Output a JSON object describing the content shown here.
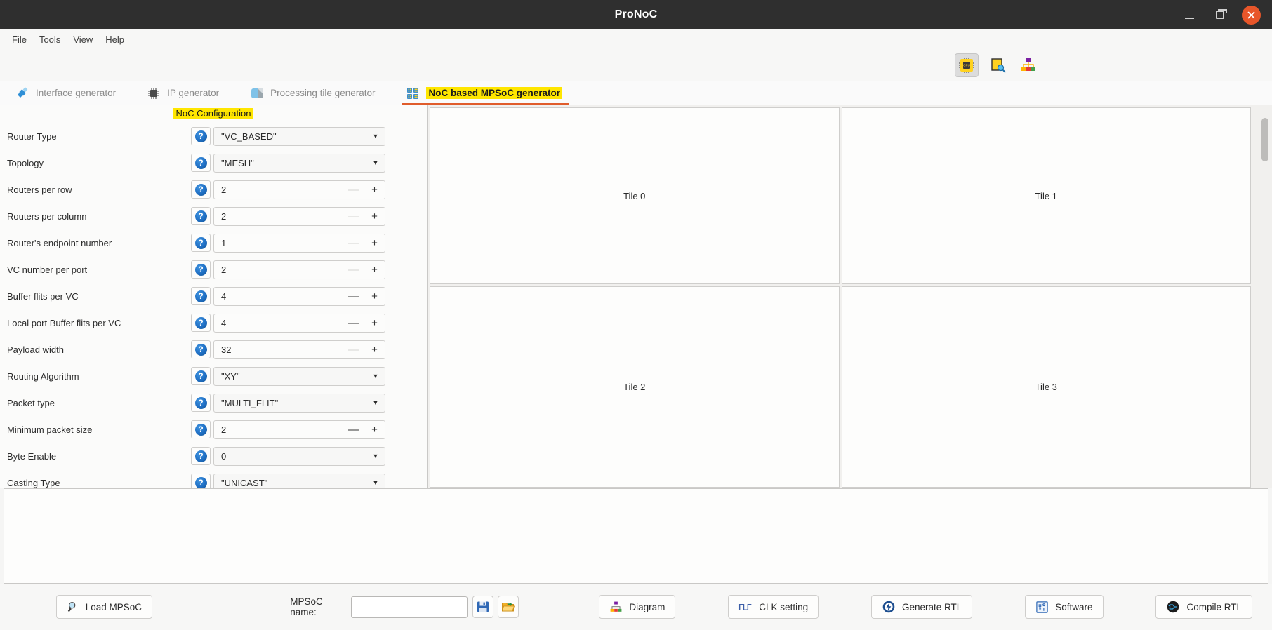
{
  "window": {
    "title": "ProNoC",
    "minimize_label": "Minimize",
    "maximize_label": "Maximize",
    "close_label": "Close"
  },
  "menubar": {
    "items": [
      {
        "label": "File"
      },
      {
        "label": "Tools"
      },
      {
        "label": "View"
      },
      {
        "label": "Help"
      }
    ]
  },
  "toolbar": {
    "buttons": [
      {
        "icon": "cpu-chip-icon",
        "active": true
      },
      {
        "icon": "document-search-icon",
        "active": false
      },
      {
        "icon": "hierarchy-diagram-icon",
        "active": false
      }
    ]
  },
  "tabs": [
    {
      "label": "Interface generator",
      "icon": "connector-plug-icon",
      "active": false
    },
    {
      "label": "IP generator",
      "icon": "ic-chip-icon",
      "active": false
    },
    {
      "label": "Processing tile generator",
      "icon": "cube-tile-icon",
      "active": false
    },
    {
      "label": "NoC based MPSoC generator",
      "icon": "grid-2x2-icon",
      "active": true
    }
  ],
  "config": {
    "header": "NoC Configuration",
    "help_glyph": "?",
    "rows": [
      {
        "label": "Router Type",
        "type": "combo",
        "value": "\"VC_BASED\""
      },
      {
        "label": "Topology",
        "type": "combo",
        "value": "\"MESH\""
      },
      {
        "label": "Routers per row",
        "type": "spinner",
        "value": "2",
        "minus_enabled": false,
        "plus_enabled": true
      },
      {
        "label": "Routers per column",
        "type": "spinner",
        "value": "2",
        "minus_enabled": false,
        "plus_enabled": true
      },
      {
        "label": "Router's endpoint number",
        "type": "spinner",
        "value": "1",
        "minus_enabled": false,
        "plus_enabled": true
      },
      {
        "label": "VC number per port",
        "type": "spinner",
        "value": "2",
        "minus_enabled": false,
        "plus_enabled": true
      },
      {
        "label": "Buffer flits per VC",
        "type": "spinner",
        "value": "4",
        "minus_enabled": true,
        "plus_enabled": true
      },
      {
        "label": "Local port Buffer flits per VC",
        "type": "spinner",
        "value": "4",
        "minus_enabled": true,
        "plus_enabled": true
      },
      {
        "label": "Payload width",
        "type": "spinner",
        "value": "32",
        "minus_enabled": false,
        "plus_enabled": true
      },
      {
        "label": "Routing Algorithm",
        "type": "combo",
        "value": "\"XY\""
      },
      {
        "label": "Packet type",
        "type": "combo",
        "value": "\"MULTI_FLIT\""
      },
      {
        "label": "Minimum packet size",
        "type": "spinner",
        "value": "2",
        "minus_enabled": true,
        "plus_enabled": true
      },
      {
        "label": "Byte Enable",
        "type": "combo",
        "value": "0"
      },
      {
        "label": "Casting Type",
        "type": "combo",
        "value": "\"UNICAST\""
      }
    ],
    "minus_glyph": "—",
    "plus_glyph": "+",
    "arrow_glyph": "▼"
  },
  "tiles": [
    {
      "label": "Tile 0"
    },
    {
      "label": "Tile 1"
    },
    {
      "label": "Tile 2"
    },
    {
      "label": "Tile 3"
    }
  ],
  "bottombar": {
    "load_mpsoc": "Load MPSoC",
    "mpsoc_name_label": "MPSoC name:",
    "mpsoc_name_value": "",
    "mpsoc_name_placeholder": "",
    "save_icon": "floppy-disk-icon",
    "open_icon": "open-folder-icon",
    "diagram": "Diagram",
    "clk_setting": "CLK setting",
    "generate_rtl": "Generate RTL",
    "software": "Software",
    "compile_rtl": "Compile RTL"
  },
  "colors": {
    "titlebar_bg": "#2f2f2f",
    "close_btn": "#e8562a",
    "highlight_yellow": "#ffe600",
    "active_tab_underline": "#e05c2b",
    "help_blue": "#1f6fc4"
  }
}
